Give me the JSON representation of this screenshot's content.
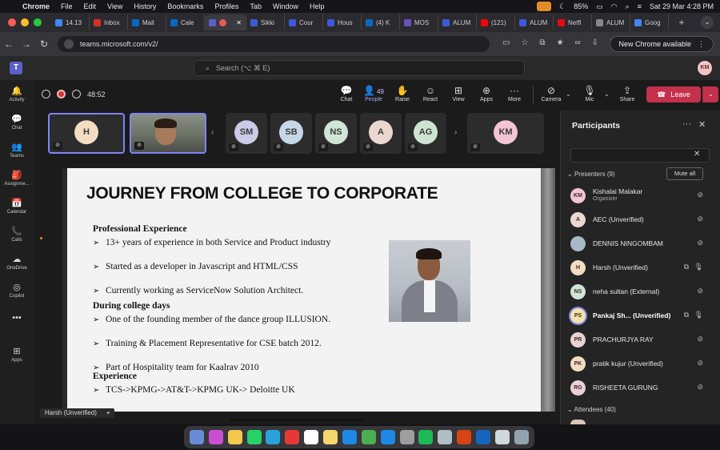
{
  "menubar": {
    "app_name": "Chrome",
    "items": [
      "File",
      "Edit",
      "View",
      "History",
      "Bookmarks",
      "Profiles",
      "Tab",
      "Window",
      "Help"
    ],
    "battery": "85%",
    "datetime": "Sat 29 Mar  4:28 PM"
  },
  "tabs": [
    {
      "label": "14.13",
      "color": "#4285f4"
    },
    {
      "label": "Inbox",
      "color": "#d93025"
    },
    {
      "label": "Mail",
      "color": "#0a66c2"
    },
    {
      "label": "Cale",
      "color": "#0a66c2"
    },
    {
      "label": "",
      "color": "#5b5fc7",
      "active": true
    },
    {
      "label": "Sikki",
      "color": "#3b5bdb"
    },
    {
      "label": "Cour",
      "color": "#3b5bdb"
    },
    {
      "label": "Hous",
      "color": "#3b5bdb"
    },
    {
      "label": "(4) K",
      "color": "#0a66c2"
    },
    {
      "label": "MOS",
      "color": "#6b4fbb"
    },
    {
      "label": "ALUM",
      "color": "#3b5bdb"
    },
    {
      "label": "(121)",
      "color": "#ff0000"
    },
    {
      "label": "ALUM",
      "color": "#3b5bdb"
    },
    {
      "label": "Netfl",
      "color": "#e50914"
    },
    {
      "label": "ALUM",
      "color": "#888888"
    },
    {
      "label": "Goog",
      "color": "#4285f4"
    }
  ],
  "address": {
    "url": "teams.microsoft.com/v2/",
    "update_label": "New Chrome available"
  },
  "teams": {
    "search_placeholder": "Search (⌥ ⌘ E)",
    "user_initials": "KM"
  },
  "rail": [
    {
      "label": "Activity",
      "icon": "bell-icon",
      "glyph": "🔔"
    },
    {
      "label": "Chat",
      "icon": "chat-icon",
      "glyph": "💬"
    },
    {
      "label": "Teams",
      "icon": "teams-icon",
      "glyph": "👥"
    },
    {
      "label": "Assignme...",
      "icon": "assignments-icon",
      "glyph": "🎒"
    },
    {
      "label": "Calendar",
      "icon": "calendar-icon",
      "glyph": "📅"
    },
    {
      "label": "Calls",
      "icon": "phone-icon",
      "glyph": "📞"
    },
    {
      "label": "OneDrive",
      "icon": "cloud-icon",
      "glyph": "☁"
    },
    {
      "label": "Copilot",
      "icon": "copilot-icon",
      "glyph": "◎"
    },
    {
      "label": "",
      "icon": "more-icon",
      "glyph": "•••"
    },
    {
      "label": "Apps",
      "icon": "apps-icon",
      "glyph": "⊞"
    }
  ],
  "meeting": {
    "timer": "48:52",
    "controls": {
      "chat": "Chat",
      "people": "People",
      "people_count": "49",
      "raise": "Raise",
      "react": "React",
      "view": "View",
      "apps": "Apps",
      "more": "More",
      "camera": "Camera",
      "mic": "Mic",
      "share": "Share",
      "leave": "Leave"
    }
  },
  "strip": [
    {
      "initials": "H",
      "color": "#f3dcc2",
      "selected": true
    },
    {
      "initials": "",
      "video": true,
      "selected": true
    },
    {
      "initials": "SM",
      "color": "#c9cbe8"
    },
    {
      "initials": "SB",
      "color": "#c6d7e8"
    },
    {
      "initials": "NS",
      "color": "#cfe5d6"
    },
    {
      "initials": "A",
      "color": "#ead7cf"
    },
    {
      "initials": "AG",
      "color": "#cfe3d1"
    },
    {
      "initials": "KM",
      "color": "#f2c4d4"
    }
  ],
  "slide": {
    "title": "JOURNEY FROM COLLEGE TO CORPORATE",
    "sections": [
      {
        "heading": "Professional Experience",
        "bullets": [
          "13+ years of experience in both Service and Product industry",
          "Started as a developer in Javascript and HTML/CSS",
          "Currently working as ServiceNow Solution Architect."
        ]
      },
      {
        "heading": "During college days",
        "bullets": [
          "One of the founding member of the dance group ILLUSION.",
          "Training & Placement Representative for CSE batch 2012.",
          "Part of Hospitality team for Kaalrav 2010"
        ]
      },
      {
        "heading": "Experience",
        "bullets": [
          "TCS->KPMG->AT&T->KPMG UK-> Deloitte UK"
        ]
      }
    ],
    "sharer_label": "Harsh (Unverified)"
  },
  "participants": {
    "title": "Participants",
    "presenters_label": "Presenters (9)",
    "mute_all": "Mute all",
    "attendees_label": "Attendees (40)",
    "presenters": [
      {
        "initials": "KM",
        "name": "Kishalai Malakar",
        "sub": "Organizer",
        "color": "#f2c4d4",
        "mic": "muted"
      },
      {
        "initials": "A",
        "name": "AEC (Unverified)",
        "color": "#ead7cf",
        "mic": "muted"
      },
      {
        "initials": "",
        "name": "DENNIS NINGOMBAM",
        "color": "#a9b8c7",
        "mic": "muted"
      },
      {
        "initials": "H",
        "name": "Harsh (Unverified)",
        "color": "#f3dcc2",
        "mic": "on",
        "sharing": true
      },
      {
        "initials": "NS",
        "name": "neha sultan (External)",
        "color": "#cfe5d6",
        "mic": "muted"
      },
      {
        "initials": "PS",
        "name": "Pankaj Sh... (Unverified)",
        "color": "#f5e3a8",
        "mic": "on",
        "sharing": true,
        "bold": true
      },
      {
        "initials": "PR",
        "name": "PRACHURJYA RAY",
        "color": "#e8d2d2",
        "mic": "muted"
      },
      {
        "initials": "PK",
        "name": "pratik kujur (Unverified)",
        "color": "#f3dcc2",
        "mic": "muted"
      },
      {
        "initials": "RG",
        "name": "RISHEETA GURUNG",
        "color": "#ecd0d6",
        "mic": "muted"
      }
    ]
  },
  "dock_colors": [
    "#6b8ad8",
    "#c94fd1",
    "#f2c94c",
    "#25d366",
    "#2aa1da",
    "#e53935",
    "#ffffff",
    "#f5d76e",
    "#1e88e5",
    "#4caf50",
    "#1e88e5",
    "#9e9e9e",
    "#1db954",
    "#b0bec5",
    "#d84315",
    "#1565c0",
    "#cfd8dc",
    "#90a4ae"
  ]
}
